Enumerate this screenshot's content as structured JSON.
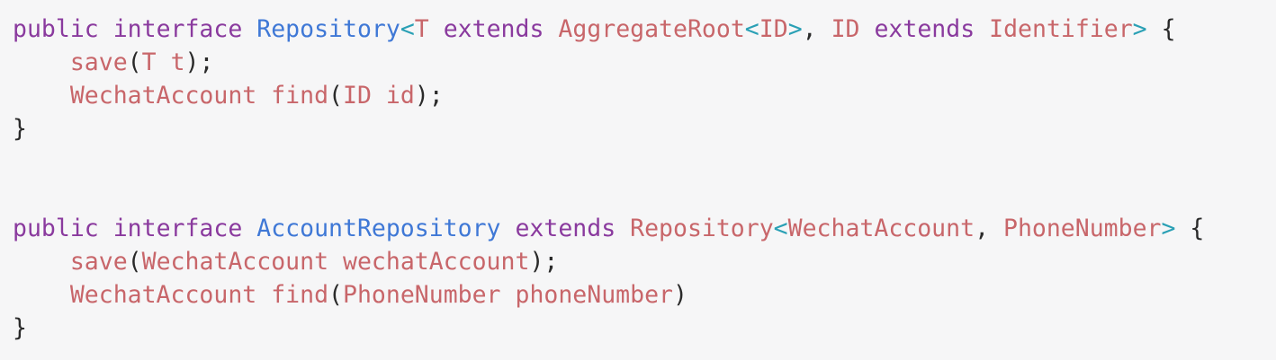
{
  "colors": {
    "background": "#f6f6f7",
    "keyword": "#8a3a9e",
    "type": "#3f78d6",
    "generic_bracket": "#2aa0b5",
    "identifier": "#c8666a",
    "punctuation": "#2a2a2a"
  },
  "code": {
    "lines": [
      {
        "tokens": [
          {
            "t": "public",
            "k": "kw"
          },
          {
            "t": " ",
            "k": "pun"
          },
          {
            "t": "interface",
            "k": "kw"
          },
          {
            "t": " ",
            "k": "pun"
          },
          {
            "t": "Repository",
            "k": "type"
          },
          {
            "t": "<",
            "k": "gen"
          },
          {
            "t": "T",
            "k": "id"
          },
          {
            "t": " ",
            "k": "pun"
          },
          {
            "t": "extends",
            "k": "kw"
          },
          {
            "t": " ",
            "k": "pun"
          },
          {
            "t": "AggregateRoot",
            "k": "id"
          },
          {
            "t": "<",
            "k": "gen"
          },
          {
            "t": "ID",
            "k": "id"
          },
          {
            "t": ">",
            "k": "gen"
          },
          {
            "t": ", ",
            "k": "pun"
          },
          {
            "t": "ID",
            "k": "id"
          },
          {
            "t": " ",
            "k": "pun"
          },
          {
            "t": "extends",
            "k": "kw"
          },
          {
            "t": " ",
            "k": "pun"
          },
          {
            "t": "Identifier",
            "k": "id"
          },
          {
            "t": ">",
            "k": "gen"
          },
          {
            "t": " {",
            "k": "pun"
          }
        ]
      },
      {
        "tokens": [
          {
            "t": "    ",
            "k": "pun"
          },
          {
            "t": "save",
            "k": "id"
          },
          {
            "t": "(",
            "k": "pun"
          },
          {
            "t": "T",
            "k": "id"
          },
          {
            "t": " ",
            "k": "pun"
          },
          {
            "t": "t",
            "k": "id"
          },
          {
            "t": ");",
            "k": "pun"
          }
        ]
      },
      {
        "tokens": [
          {
            "t": "    ",
            "k": "pun"
          },
          {
            "t": "WechatAccount",
            "k": "id"
          },
          {
            "t": " ",
            "k": "pun"
          },
          {
            "t": "find",
            "k": "id"
          },
          {
            "t": "(",
            "k": "pun"
          },
          {
            "t": "ID",
            "k": "id"
          },
          {
            "t": " ",
            "k": "pun"
          },
          {
            "t": "id",
            "k": "id"
          },
          {
            "t": ");",
            "k": "pun"
          }
        ]
      },
      {
        "tokens": [
          {
            "t": "}",
            "k": "pun"
          }
        ]
      },
      {
        "tokens": []
      },
      {
        "tokens": []
      },
      {
        "tokens": [
          {
            "t": "public",
            "k": "kw"
          },
          {
            "t": " ",
            "k": "pun"
          },
          {
            "t": "interface",
            "k": "kw"
          },
          {
            "t": " ",
            "k": "pun"
          },
          {
            "t": "AccountRepository",
            "k": "type"
          },
          {
            "t": " ",
            "k": "pun"
          },
          {
            "t": "extends",
            "k": "kw"
          },
          {
            "t": " ",
            "k": "pun"
          },
          {
            "t": "Repository",
            "k": "id"
          },
          {
            "t": "<",
            "k": "gen"
          },
          {
            "t": "WechatAccount",
            "k": "id"
          },
          {
            "t": ", ",
            "k": "pun"
          },
          {
            "t": "PhoneNumber",
            "k": "id"
          },
          {
            "t": ">",
            "k": "gen"
          },
          {
            "t": " {",
            "k": "pun"
          }
        ]
      },
      {
        "tokens": [
          {
            "t": "    ",
            "k": "pun"
          },
          {
            "t": "save",
            "k": "id"
          },
          {
            "t": "(",
            "k": "pun"
          },
          {
            "t": "WechatAccount",
            "k": "id"
          },
          {
            "t": " ",
            "k": "pun"
          },
          {
            "t": "wechatAccount",
            "k": "id"
          },
          {
            "t": ");",
            "k": "pun"
          }
        ]
      },
      {
        "tokens": [
          {
            "t": "    ",
            "k": "pun"
          },
          {
            "t": "WechatAccount",
            "k": "id"
          },
          {
            "t": " ",
            "k": "pun"
          },
          {
            "t": "find",
            "k": "id"
          },
          {
            "t": "(",
            "k": "pun"
          },
          {
            "t": "PhoneNumber",
            "k": "id"
          },
          {
            "t": " ",
            "k": "pun"
          },
          {
            "t": "phoneNumber",
            "k": "id"
          },
          {
            "t": ")",
            "k": "pun"
          }
        ]
      },
      {
        "tokens": [
          {
            "t": "}",
            "k": "pun"
          }
        ]
      }
    ]
  }
}
